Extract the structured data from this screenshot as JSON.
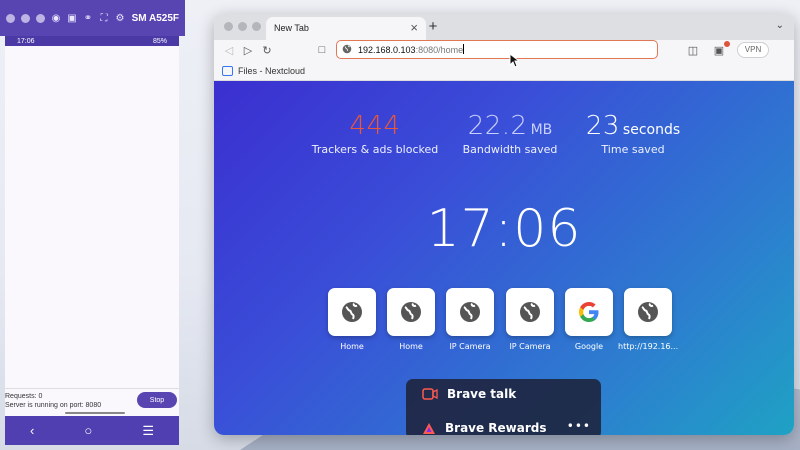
{
  "colors": {
    "accent": "#e27754",
    "emulator": "#5845b2",
    "trackers": "#e8573a",
    "bandwidth": "#c9cfff"
  },
  "phone": {
    "title": "SM A525F",
    "status_time": "17:06",
    "status_right": "85%",
    "requests_text": "Requests: 0",
    "server_text": "Server is running on port: 8080",
    "stop_label": "Stop"
  },
  "browser": {
    "tab_title": "New Tab",
    "new_tab_label": "+",
    "url_host": "192.168.0.103",
    "url_rest": ":8080/home",
    "vpn_label": "VPN",
    "bookmark_label": "Files - Nextcloud"
  },
  "ntp": {
    "trackers_count": "444",
    "trackers_label": "Trackers & ads blocked",
    "bandwidth_value": "22.2",
    "bandwidth_unit": "MB",
    "bandwidth_label": "Bandwidth saved",
    "time_value": "23",
    "time_unit": "seconds",
    "time_label": "Time saved",
    "clock": "17:06",
    "tiles": [
      {
        "label": "Home",
        "icon": "globe-icon"
      },
      {
        "label": "Home",
        "icon": "globe-icon"
      },
      {
        "label": "IP Camera",
        "icon": "globe-icon"
      },
      {
        "label": "IP Camera",
        "icon": "globe-icon"
      },
      {
        "label": "Google",
        "icon": "google-icon"
      },
      {
        "label": "http://192.16...",
        "icon": "globe-icon"
      }
    ],
    "cards": [
      {
        "label": "Brave talk",
        "icon": "video-icon"
      },
      {
        "label": "Brave Rewards",
        "icon": "rewards-icon"
      }
    ],
    "more_label": "•••"
  }
}
